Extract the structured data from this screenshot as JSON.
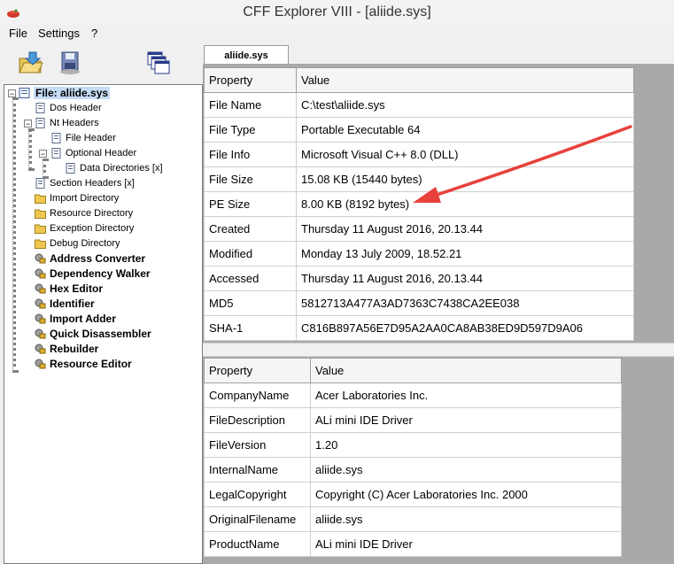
{
  "window": {
    "title": "CFF Explorer VIII - [aliide.sys]"
  },
  "menu": [
    "File",
    "Settings",
    "?"
  ],
  "tab": {
    "label": "aliide.sys"
  },
  "tree": {
    "root": "File: aliide.sys",
    "items": [
      {
        "label": "Dos Header"
      },
      {
        "label": "Nt Headers"
      },
      {
        "label": "File Header"
      },
      {
        "label": "Optional Header"
      },
      {
        "label": "Data Directories [x]"
      },
      {
        "label": "Section Headers [x]"
      },
      {
        "label": "Import Directory"
      },
      {
        "label": "Resource Directory"
      },
      {
        "label": "Exception Directory"
      },
      {
        "label": "Debug Directory"
      },
      {
        "label": "Address Converter"
      },
      {
        "label": "Dependency Walker"
      },
      {
        "label": "Hex Editor"
      },
      {
        "label": "Identifier"
      },
      {
        "label": "Import Adder"
      },
      {
        "label": "Quick Disassembler"
      },
      {
        "label": "Rebuilder"
      },
      {
        "label": "Resource Editor"
      }
    ]
  },
  "file_props": {
    "headers": [
      "Property",
      "Value"
    ],
    "rows": [
      [
        "File Name",
        "C:\\test\\aliide.sys"
      ],
      [
        "File Type",
        "Portable Executable 64"
      ],
      [
        "File Info",
        "Microsoft Visual C++ 8.0 (DLL)"
      ],
      [
        "File Size",
        "15.08 KB (15440 bytes)"
      ],
      [
        "PE Size",
        "8.00 KB (8192 bytes)"
      ],
      [
        "Created",
        "Thursday 11 August 2016, 20.13.44"
      ],
      [
        "Modified",
        "Monday 13 July 2009, 18.52.21"
      ],
      [
        "Accessed",
        "Thursday 11 August 2016, 20.13.44"
      ],
      [
        "MD5",
        "5812713A477A3AD7363C7438CA2EE038"
      ],
      [
        "SHA-1",
        "C816B897A56E7D95A2AA0CA8AB38ED9D597D9A06"
      ]
    ]
  },
  "version_props": {
    "headers": [
      "Property",
      "Value"
    ],
    "rows": [
      [
        "CompanyName",
        "Acer Laboratories Inc."
      ],
      [
        "FileDescription",
        "ALi mini IDE Driver"
      ],
      [
        "FileVersion",
        "1.20"
      ],
      [
        "InternalName",
        "aliide.sys"
      ],
      [
        "LegalCopyright",
        "Copyright (C) Acer Laboratories Inc.  2000"
      ],
      [
        "OriginalFilename",
        "aliide.sys"
      ],
      [
        "ProductName",
        "ALi mini IDE Driver"
      ]
    ]
  },
  "colors": {
    "annotation_arrow": "#e8413c",
    "selection": "#c5dcf5",
    "content_background": "#a9a9a9"
  }
}
